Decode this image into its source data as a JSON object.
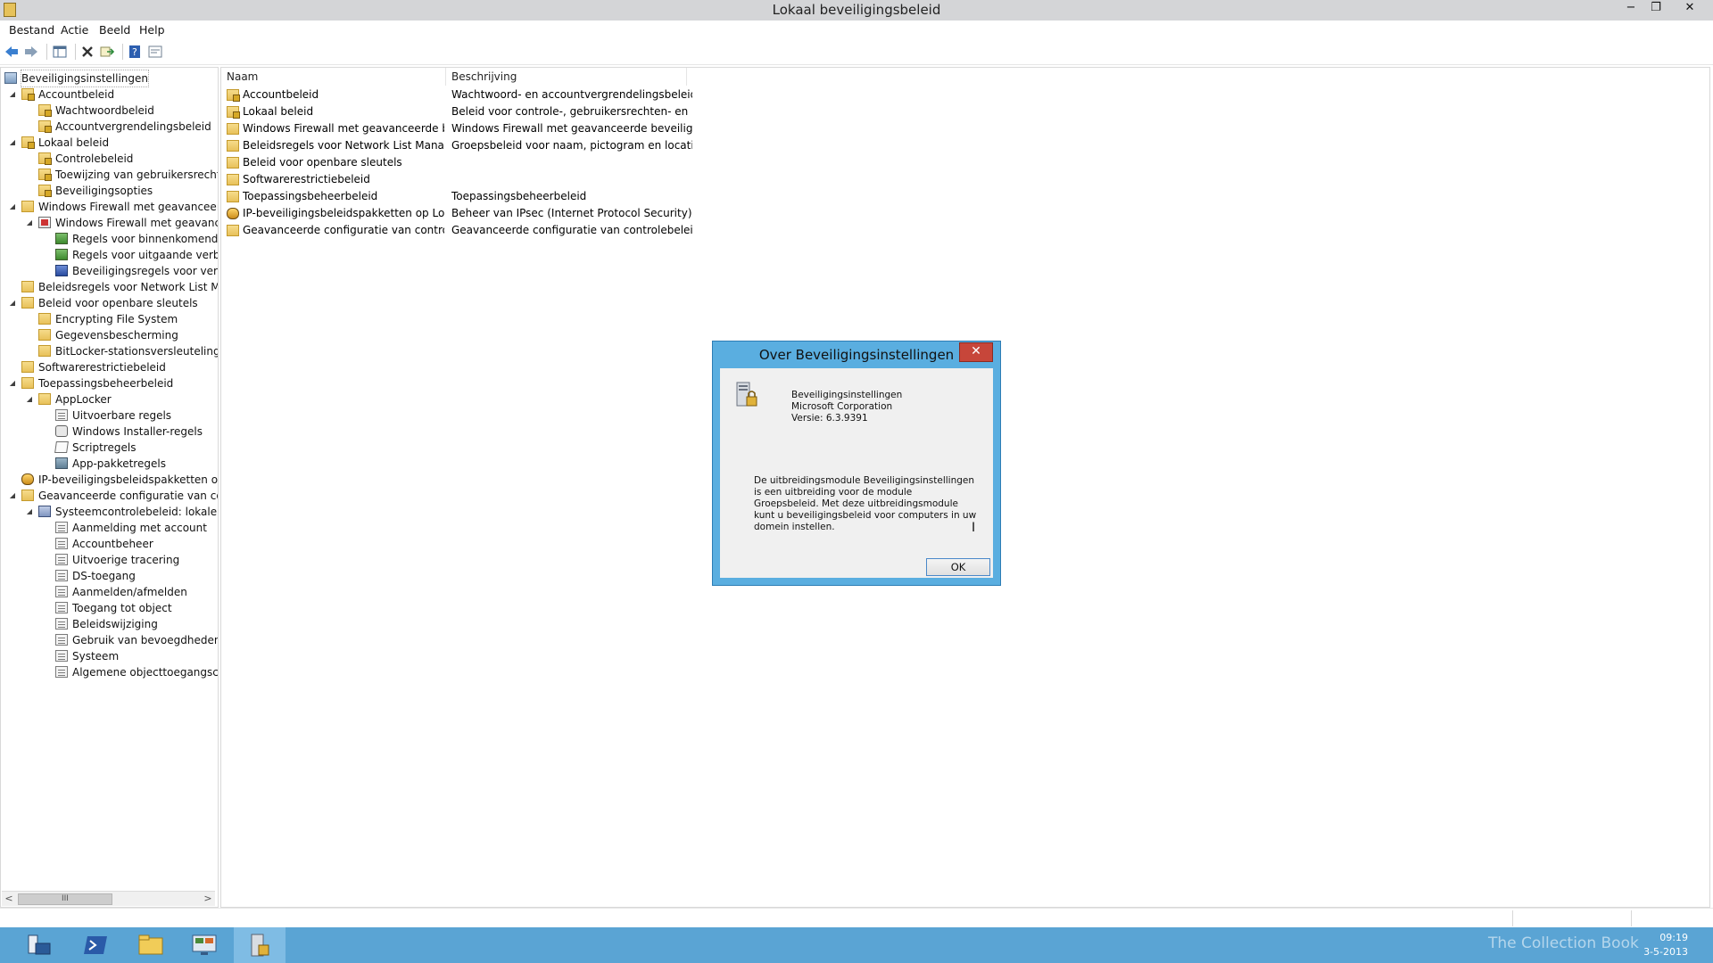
{
  "window": {
    "title": "Lokaal beveiligingsbeleid",
    "controls": {
      "minimize": "−",
      "restore": "❐",
      "close": "✕"
    }
  },
  "menu": [
    "Bestand",
    "Actie",
    "Beeld",
    "Help"
  ],
  "toolbar": {
    "buttons": [
      "back-icon",
      "forward-icon",
      "show-hide-tree-icon",
      "delete-icon",
      "export-icon",
      "help-icon",
      "properties-icon"
    ]
  },
  "tree": {
    "items": [
      {
        "label": "Beveiligingsinstellingen",
        "level": 0,
        "expander": "",
        "icon": "shieldpc",
        "selected": true
      },
      {
        "label": "Accountbeleid",
        "level": 0,
        "expander": "◢",
        "icon": "lockfolder"
      },
      {
        "label": "Wachtwoordbeleid",
        "level": 1,
        "expander": "",
        "icon": "lockfolder"
      },
      {
        "label": "Accountvergrendelingsbeleid",
        "level": 1,
        "expander": "",
        "icon": "lockfolder"
      },
      {
        "label": "Lokaal beleid",
        "level": 0,
        "expander": "◢",
        "icon": "lockfolder"
      },
      {
        "label": "Controlebeleid",
        "level": 1,
        "expander": "",
        "icon": "lockfolder"
      },
      {
        "label": "Toewijzing van gebruikersrechten",
        "level": 1,
        "expander": "",
        "icon": "lockfolder"
      },
      {
        "label": "Beveiligingsopties",
        "level": 1,
        "expander": "",
        "icon": "lockfolder"
      },
      {
        "label": "Windows Firewall met geavanceerde b",
        "level": 0,
        "expander": "◢",
        "icon": "folder"
      },
      {
        "label": "Windows Firewall met geavanceer",
        "level": 1,
        "expander": "◢",
        "icon": "firewall"
      },
      {
        "label": "Regels voor binnenkomende v",
        "level": 2,
        "expander": "",
        "icon": "rules"
      },
      {
        "label": "Regels voor uitgaande verbind",
        "level": 2,
        "expander": "",
        "icon": "rules"
      },
      {
        "label": "Beveiligingsregels voor verbind",
        "level": 2,
        "expander": "",
        "icon": "netsec"
      },
      {
        "label": "Beleidsregels voor Network List Mana",
        "level": 0,
        "expander": "",
        "icon": "folder"
      },
      {
        "label": "Beleid voor openbare sleutels",
        "level": 0,
        "expander": "◢",
        "icon": "folder"
      },
      {
        "label": "Encrypting File System",
        "level": 1,
        "expander": "",
        "icon": "folder"
      },
      {
        "label": "Gegevensbescherming",
        "level": 1,
        "expander": "",
        "icon": "folder"
      },
      {
        "label": "BitLocker-stationsversleuteling",
        "level": 1,
        "expander": "",
        "icon": "folder"
      },
      {
        "label": "Softwarerestrictiebeleid",
        "level": 0,
        "expander": "",
        "icon": "folder"
      },
      {
        "label": "Toepassingsbeheerbeleid",
        "level": 0,
        "expander": "◢",
        "icon": "folder"
      },
      {
        "label": "AppLocker",
        "level": 1,
        "expander": "◢",
        "icon": "folder"
      },
      {
        "label": "Uitvoerbare regels",
        "level": 2,
        "expander": "",
        "icon": "doc"
      },
      {
        "label": "Windows Installer-regels",
        "level": 2,
        "expander": "",
        "icon": "disk"
      },
      {
        "label": "Scriptregels",
        "level": 2,
        "expander": "",
        "icon": "script"
      },
      {
        "label": "App-pakketregels",
        "level": 2,
        "expander": "",
        "icon": "pkg"
      },
      {
        "label": "IP-beveiligingsbeleidspakketten op Lo",
        "level": 0,
        "expander": "",
        "icon": "ipsec"
      },
      {
        "label": "Geavanceerde configuratie van contro",
        "level": 0,
        "expander": "◢",
        "icon": "folder"
      },
      {
        "label": "Systeemcontrolebeleid: lokale gro",
        "level": 1,
        "expander": "◢",
        "icon": "audit"
      },
      {
        "label": "Aanmelding met account",
        "level": 2,
        "expander": "",
        "icon": "doc"
      },
      {
        "label": "Accountbeheer",
        "level": 2,
        "expander": "",
        "icon": "doc"
      },
      {
        "label": "Uitvoerige tracering",
        "level": 2,
        "expander": "",
        "icon": "doc"
      },
      {
        "label": "DS-toegang",
        "level": 2,
        "expander": "",
        "icon": "doc"
      },
      {
        "label": "Aanmelden/afmelden",
        "level": 2,
        "expander": "",
        "icon": "doc"
      },
      {
        "label": "Toegang tot object",
        "level": 2,
        "expander": "",
        "icon": "doc"
      },
      {
        "label": "Beleidswijziging",
        "level": 2,
        "expander": "",
        "icon": "doc"
      },
      {
        "label": "Gebruik van bevoegdheden",
        "level": 2,
        "expander": "",
        "icon": "doc"
      },
      {
        "label": "Systeem",
        "level": 2,
        "expander": "",
        "icon": "doc"
      },
      {
        "label": "Algemene objecttoegangscon",
        "level": 2,
        "expander": "",
        "icon": "doc"
      }
    ],
    "scroll": {
      "left": "<",
      "right": ">",
      "grip": "III"
    }
  },
  "list": {
    "columns": [
      "Naam",
      "Beschrijving"
    ],
    "rows": [
      {
        "name": "Accountbeleid",
        "desc": "Wachtwoord- en accountvergrendelingsbeleid",
        "icon": "lockfolder"
      },
      {
        "name": "Lokaal beleid",
        "desc": "Beleid voor controle-, gebruikersrechten- en be...",
        "icon": "lockfolder"
      },
      {
        "name": "Windows Firewall met geavanceerde bev...",
        "desc": "Windows Firewall met geavanceerde beveiliging",
        "icon": "folder"
      },
      {
        "name": "Beleidsregels voor Network List Manager",
        "desc": "Groepsbeleid voor naam, pictogram en locatie ...",
        "icon": "folder"
      },
      {
        "name": "Beleid voor openbare sleutels",
        "desc": "",
        "icon": "folder"
      },
      {
        "name": "Softwarerestrictiebeleid",
        "desc": "",
        "icon": "folder"
      },
      {
        "name": "Toepassingsbeheerbeleid",
        "desc": "Toepassingsbeheerbeleid",
        "icon": "folder"
      },
      {
        "name": "IP-beveiligingsbeleidspakketten op Lokal...",
        "desc": "Beheer van IPsec (Internet Protocol Security). H...",
        "icon": "ipsec"
      },
      {
        "name": "Geavanceerde configuratie van controleb...",
        "desc": "Geavanceerde configuratie van controlebeleid",
        "icon": "folder"
      }
    ]
  },
  "dialog": {
    "title": "Over Beveiligingsinstellingen",
    "close": "✕",
    "product": "Beveiligingsinstellingen",
    "company": "Microsoft Corporation",
    "version": "Versie: 6.3.9391",
    "description": "De uitbreidingsmodule Beveiligingsinstellingen is een uitbreiding voor de module Groepsbeleid. Met deze uitbreidingsmodule kunt u beveiligingsbeleid voor computers in uw domein instellen.",
    "ok_label": "OK"
  },
  "taskbar": {
    "items": [
      "server-manager-icon",
      "powershell-icon",
      "file-explorer-icon",
      "control-panel-icon",
      "local-security-policy-icon"
    ],
    "time": "09:19",
    "date": "3-5-2013",
    "watermark": "The Collection Book",
    "accent": "#5aa4d4"
  }
}
